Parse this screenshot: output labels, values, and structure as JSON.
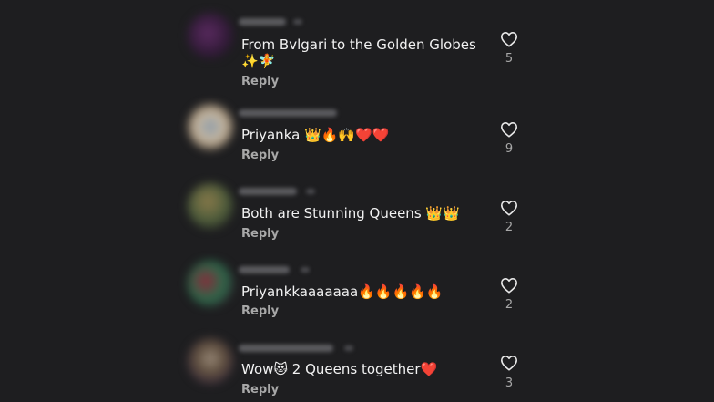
{
  "comments": [
    {
      "text_line1": "From Bvlgari to the Golden Globes",
      "text_line2": "✨🧚",
      "reply_label": "Reply",
      "likes": "5",
      "avatar_colors": [
        "#3a1e46",
        "#5a2a60"
      ]
    },
    {
      "text_line1": "Priyanka 👑🔥🙌❤️❤️",
      "reply_label": "Reply",
      "likes": "9",
      "avatar_colors": [
        "#c8b8a8",
        "#8090a0"
      ]
    },
    {
      "text_line1": "Both are Stunning Queens 👑👑",
      "reply_label": "Reply",
      "likes": "2",
      "avatar_colors": [
        "#7a6a3a",
        "#3a5a4a"
      ]
    },
    {
      "text_line1": "Priyankkaaaaaaa🔥🔥🔥🔥🔥",
      "reply_label": "Reply",
      "likes": "2",
      "avatar_colors": [
        "#6a2a3a",
        "#2a6a4a"
      ]
    },
    {
      "text_line1": "Wow😻 2 Queens together❤️",
      "reply_label": "Reply",
      "likes": "3",
      "avatar_colors": [
        "#4a3a2a",
        "#8a7a6a"
      ]
    }
  ],
  "icons": {
    "like": "heart-outline-icon"
  },
  "colors": {
    "background": "#1e1e20",
    "text": "#f2f2f2",
    "secondary": "#a8a8a8"
  }
}
